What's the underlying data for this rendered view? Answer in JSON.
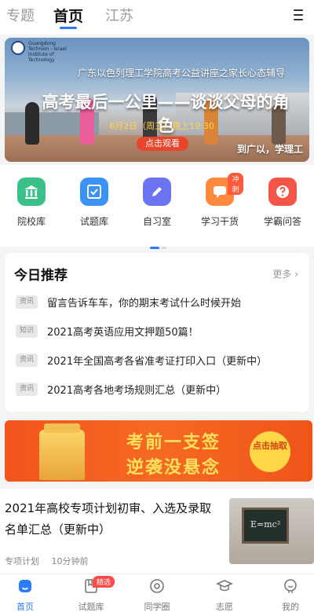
{
  "top_tabs": [
    {
      "label": "专题"
    },
    {
      "label": "首页"
    },
    {
      "label": "江苏"
    }
  ],
  "banner": {
    "school_name": "Guangdong Technion - Israel Institute of Technology",
    "subtitle": "广东以色列理工学院高考公益讲座之家长心态辅导",
    "headline": "高考最后一公里——谈谈父母的角色",
    "date_time": "6月2日（周三）晚上19:30",
    "button": "点击观看",
    "brand": "到广以，学理工"
  },
  "quick_links": [
    {
      "label": "院校库",
      "icon": "university-icon",
      "color": "#3cc08a"
    },
    {
      "label": "试题库",
      "icon": "checkbox-icon",
      "color": "#3b93f5"
    },
    {
      "label": "自习室",
      "icon": "pencil-icon",
      "color": "#6b74f0"
    },
    {
      "label": "学习干货",
      "icon": "chat-bubble-icon",
      "color": "#ff8a3d",
      "badge": "冲刺"
    },
    {
      "label": "学霸问答",
      "icon": "question-icon",
      "color": "#f4574a"
    }
  ],
  "today": {
    "title": "今日推荐",
    "more": "更多",
    "items": [
      {
        "tag": "资讯",
        "text": "留言告诉车车，你的期末考试什么时候开始"
      },
      {
        "tag": "知识",
        "text": "2021高考英语应用文押题50篇！"
      },
      {
        "tag": "资讯",
        "text": "2021年全国高考各省准考证打印入口（更新中）"
      },
      {
        "tag": "资讯",
        "text": "2021高考各地考场规则汇总（更新中）"
      }
    ]
  },
  "promo": {
    "line1": "考前一支签",
    "line2": "逆袭没悬念",
    "cta": "点击抽取"
  },
  "article": {
    "title": "2021年高校专项计划初审、入选及录取名单汇总（更新中）",
    "category": "专项计划",
    "time": "10分钟前",
    "thumb_text": "E=mc²"
  },
  "bottom_nav": [
    {
      "label": "首页",
      "icon": "home-icon",
      "active": true
    },
    {
      "label": "试题库",
      "icon": "bookmark-icon",
      "badge": "精选"
    },
    {
      "label": "同学圈",
      "icon": "circle-icon"
    },
    {
      "label": "志愿",
      "icon": "graduation-cap-icon"
    },
    {
      "label": "我的",
      "icon": "profile-icon"
    }
  ],
  "colors": {
    "accent": "#2b7cf6",
    "promo": "#f3541c",
    "promo_text": "#ffe15c"
  }
}
